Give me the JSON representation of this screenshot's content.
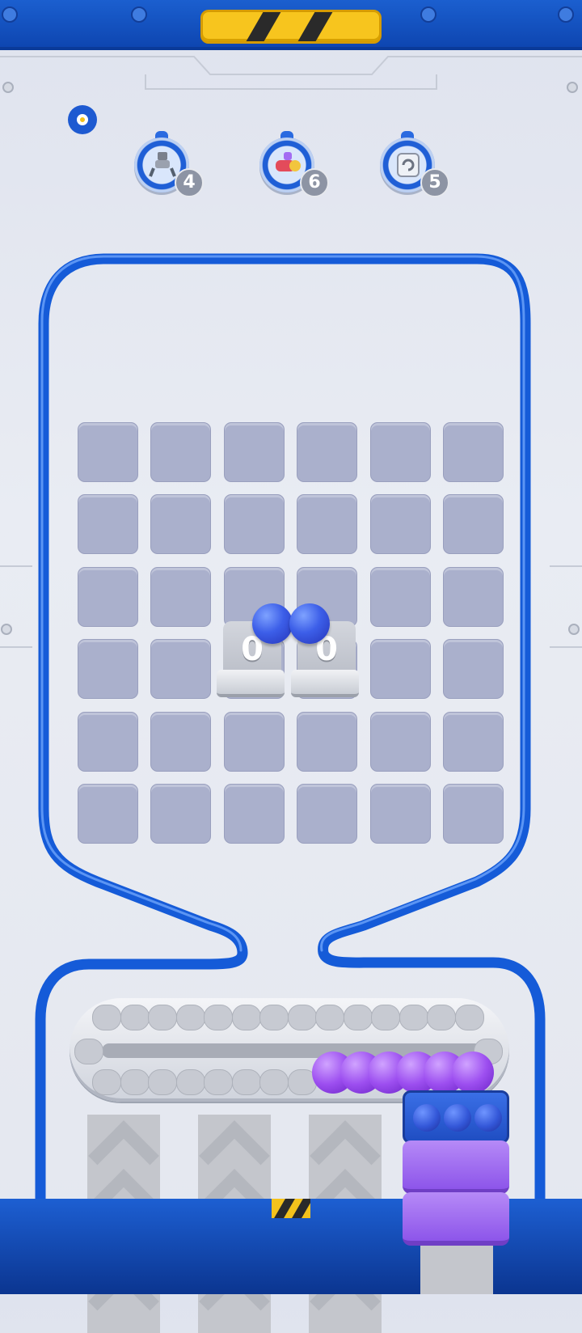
{
  "powerups": [
    {
      "name": "robot-claw",
      "count": "4"
    },
    {
      "name": "cannon",
      "count": "6"
    },
    {
      "name": "refresh-machine",
      "count": "5"
    }
  ],
  "shooters": [
    {
      "value": "0",
      "ball_color": "#3c5ee8"
    },
    {
      "value": "0",
      "ball_color": "#3c5ee8"
    }
  ],
  "grid": {
    "rows": 6,
    "cols": 6,
    "cell_color": "#aab0cc"
  },
  "conveyor": {
    "purple_balls": 6,
    "empty_slots": 24
  },
  "queue": {
    "top_balls": 3,
    "purple_blocks": 2
  },
  "colors": {
    "frame_blue": "#1b5fcf",
    "ball_blue": "#3c5ee8",
    "ball_purple": "#9d4ff0",
    "hazard_yellow": "#f7c51e"
  }
}
